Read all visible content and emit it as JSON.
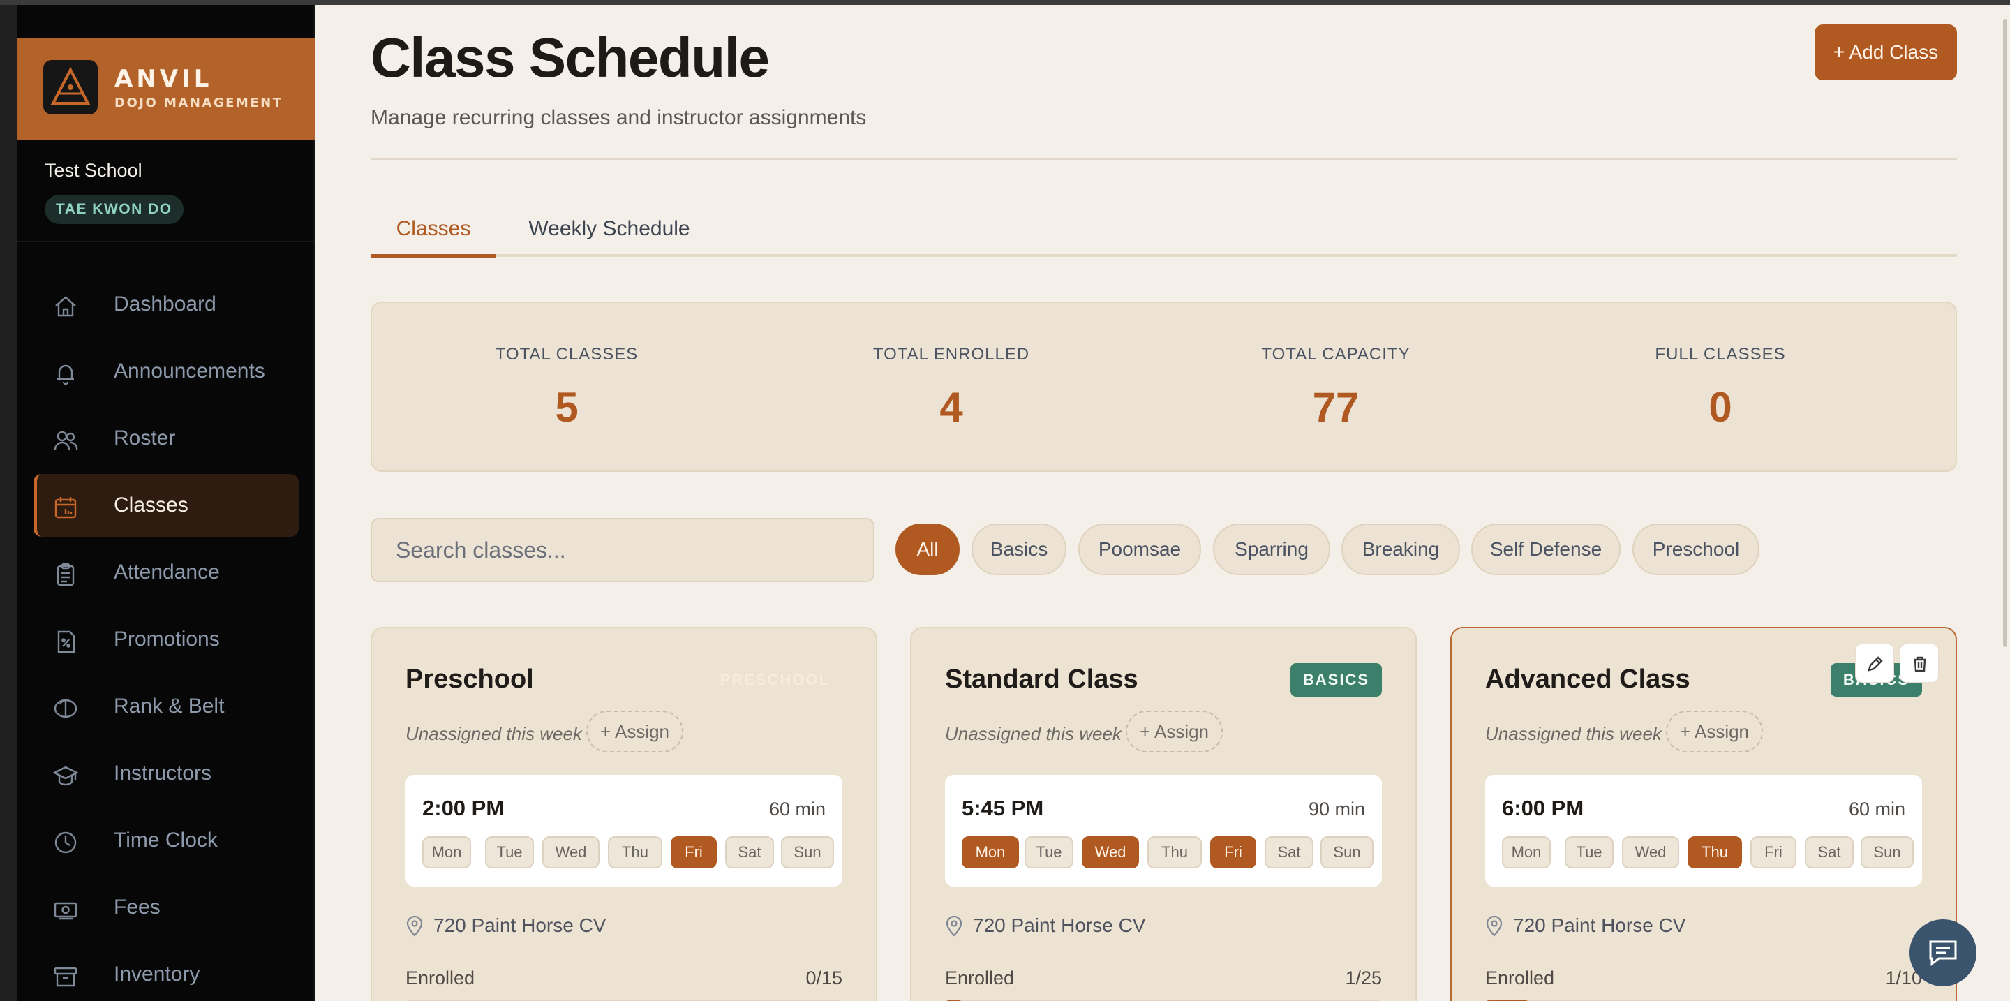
{
  "brand": {
    "name": "ANVIL",
    "subtitle": "DOJO MANAGEMENT"
  },
  "school": {
    "name": "Test School",
    "style": "TAE KWON DO"
  },
  "nav": [
    {
      "label": "Dashboard",
      "icon": "home-icon"
    },
    {
      "label": "Announcements",
      "icon": "bell-icon"
    },
    {
      "label": "Roster",
      "icon": "users-icon"
    },
    {
      "label": "Classes",
      "icon": "calendar-icon",
      "active": true
    },
    {
      "label": "Attendance",
      "icon": "clipboard-icon"
    },
    {
      "label": "Promotions",
      "icon": "badge-icon"
    },
    {
      "label": "Rank & Belt",
      "icon": "belt-icon"
    },
    {
      "label": "Instructors",
      "icon": "graduation-cap-icon"
    },
    {
      "label": "Time Clock",
      "icon": "clock-icon"
    },
    {
      "label": "Fees",
      "icon": "banknote-icon"
    },
    {
      "label": "Inventory",
      "icon": "archive-icon"
    }
  ],
  "page": {
    "title": "Class Schedule",
    "subtitle": "Manage recurring classes and instructor assignments",
    "add_button": "+ Add Class"
  },
  "tabs": [
    {
      "label": "Classes",
      "active": true
    },
    {
      "label": "Weekly Schedule",
      "active": false
    }
  ],
  "stats": [
    {
      "label": "TOTAL CLASSES",
      "value": "5"
    },
    {
      "label": "TOTAL ENROLLED",
      "value": "4"
    },
    {
      "label": "TOTAL CAPACITY",
      "value": "77"
    },
    {
      "label": "FULL CLASSES",
      "value": "0"
    }
  ],
  "search": {
    "placeholder": "Search classes..."
  },
  "filters": [
    "All",
    "Basics",
    "Poomsae",
    "Sparring",
    "Breaking",
    "Self Defense",
    "Preschool"
  ],
  "days": [
    "Mon",
    "Tue",
    "Wed",
    "Thu",
    "Fri",
    "Sat",
    "Sun"
  ],
  "cards": [
    {
      "title": "Preschool",
      "tag": "PRESCHOOL",
      "unassigned": "Unassigned this week",
      "assign": "+ Assign",
      "time": "2:00 PM",
      "duration": "60 min",
      "active_days": [
        "Fri"
      ],
      "location": "720 Paint Horse CV",
      "enrolled_label": "Enrolled",
      "enrolled": "0/15",
      "fill": 0
    },
    {
      "title": "Standard Class",
      "tag": "BASICS",
      "unassigned": "Unassigned this week",
      "assign": "+ Assign",
      "time": "5:45 PM",
      "duration": "90 min",
      "active_days": [
        "Mon",
        "Wed",
        "Fri"
      ],
      "location": "720 Paint Horse CV",
      "enrolled_label": "Enrolled",
      "enrolled": "1/25",
      "fill": 0.04
    },
    {
      "title": "Advanced Class",
      "tag": "BASICS",
      "unassigned": "Unassigned this week",
      "assign": "+ Assign",
      "time": "6:00 PM",
      "duration": "60 min",
      "active_days": [
        "Thu"
      ],
      "location": "720 Paint Horse CV",
      "enrolled_label": "Enrolled",
      "enrolled": "1/10",
      "fill": 0.1
    }
  ],
  "colors": {
    "accent": "#b05a22",
    "tag_green": "#3c7f6a",
    "sidebar": "#070707"
  }
}
